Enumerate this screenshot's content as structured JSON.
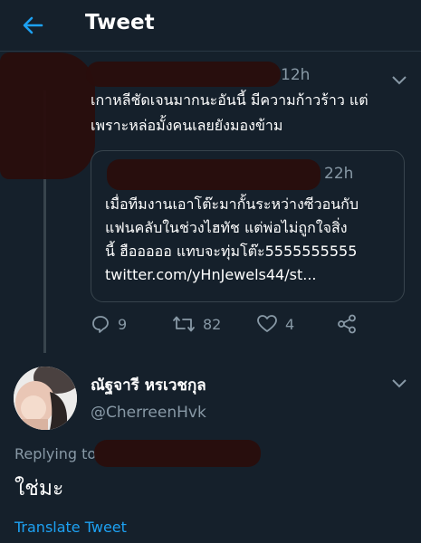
{
  "header": {
    "title": "Tweet",
    "back_icon": "arrow-left-icon",
    "accent": "#1da1f2"
  },
  "parent_tweet": {
    "time": "12h",
    "text_line1": "เกาหลีชัดเจนมากนะอันนี้ มีความก้าวร้าว แต่",
    "text_line2": "เพราะหล่อมั้งคนเลยยังมองข้าม",
    "quoted": {
      "time": "22h",
      "line1": "เมื่อทีมงานเอาโต๊ะมากั้นระหว่างซีวอนกับ",
      "line2": "แฟนคลับในช่วงไฮทัช แต่พ่อไม่ถูกใจสิ่ง",
      "line3": "นี้ ฮือออออ แทบจะทุ่มโต๊ะ5555555555",
      "line4": "twitter.com/yHnJewels44/st..."
    },
    "actions": {
      "replies": "9",
      "retweets": "82",
      "likes": "4"
    }
  },
  "reply_tweet": {
    "display_name": "ณัฐจารี หรเวชกุล",
    "handle": "@CherreenHvk",
    "replying_to": "Replying to",
    "text": "ใช่มะ",
    "translate": "Translate Tweet"
  }
}
